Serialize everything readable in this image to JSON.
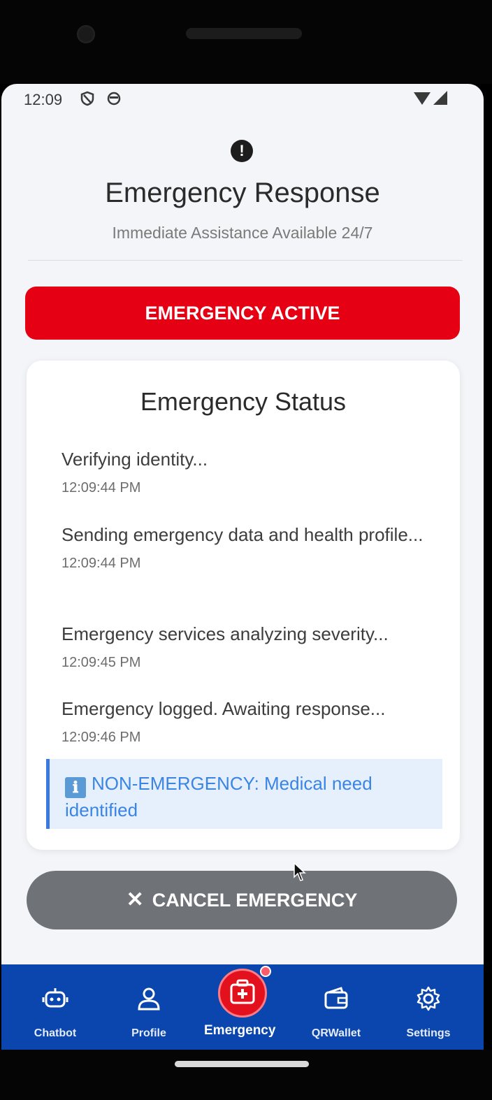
{
  "status_bar": {
    "time": "12:09"
  },
  "header": {
    "title": "Emergency Response",
    "subtitle": "Immediate Assistance Available 24/7"
  },
  "banner": {
    "label": "EMERGENCY ACTIVE",
    "color": "#e60014"
  },
  "status_card": {
    "title": "Emergency Status",
    "steps": [
      {
        "text": "Verifying identity...",
        "time": "12:09:44 PM"
      },
      {
        "text": "Sending emergency data and health profile...",
        "time": "12:09:44 PM"
      },
      {
        "text": "Emergency services analyzing severity...",
        "time": "12:09:45 PM"
      },
      {
        "text": "Emergency logged. Awaiting response...",
        "time": "12:09:46 PM"
      }
    ],
    "info": {
      "icon": "ℹ",
      "text": "NON-EMERGENCY: Medical need identified"
    }
  },
  "cancel_button": {
    "icon": "✕",
    "label": "CANCEL EMERGENCY"
  },
  "nav": {
    "items": [
      {
        "label": "Chatbot",
        "icon": "robot-icon"
      },
      {
        "label": "Profile",
        "icon": "person-icon"
      },
      {
        "label": "Emergency",
        "icon": "medical-kit-icon"
      },
      {
        "label": "QRWallet",
        "icon": "wallet-icon"
      },
      {
        "label": "Settings",
        "icon": "gear-icon"
      }
    ],
    "active_color": "#e3101e",
    "bar_color": "#0a46ad"
  }
}
